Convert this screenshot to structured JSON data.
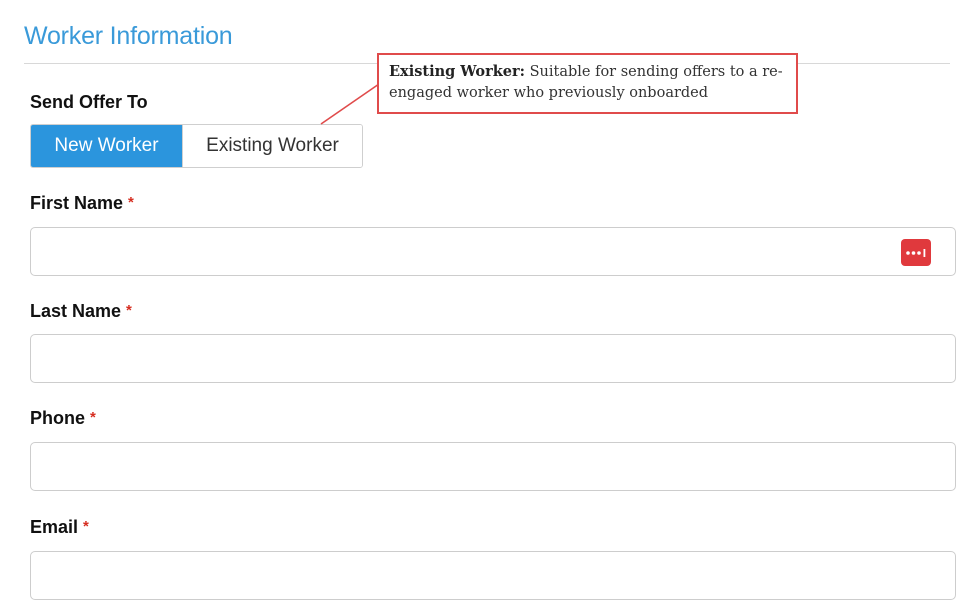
{
  "section": {
    "title": "Worker Information"
  },
  "send_offer": {
    "label": "Send Offer To",
    "options": [
      {
        "label": "New Worker",
        "selected": true
      },
      {
        "label": "Existing Worker",
        "selected": false
      }
    ]
  },
  "callout": {
    "title": "Existing Worker:",
    "body": "Suitable for sending offers to a re-engaged worker who previously onboarded",
    "border_color": "#e04b4b"
  },
  "fields": [
    {
      "label": "First Name",
      "required_mark": "*",
      "value": "",
      "has_password_manager_icon": true
    },
    {
      "label": "Last Name",
      "required_mark": "*",
      "value": ""
    },
    {
      "label": "Phone",
      "required_mark": "*",
      "value": ""
    },
    {
      "label": "Email",
      "required_mark": "*",
      "value": ""
    }
  ],
  "icons": {
    "password_manager": "password-manager-icon"
  },
  "colors": {
    "accent": "#2b95dd",
    "title": "#3a9ad9",
    "required": "#d62d20",
    "password_icon_bg": "#e0393d"
  }
}
